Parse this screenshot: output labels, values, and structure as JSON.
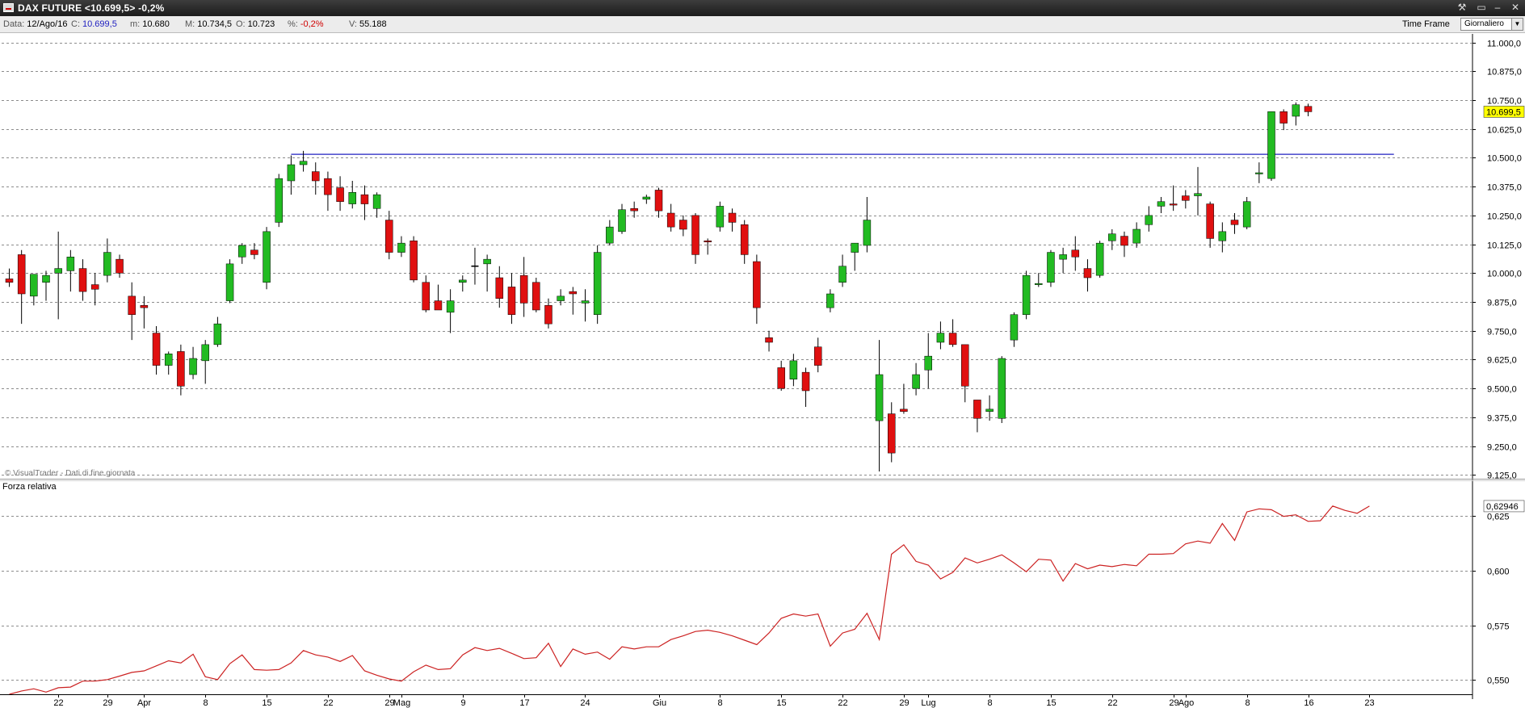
{
  "window": {
    "title": "DAX FUTURE <10.699,5> -0,2%",
    "close_glyph": "✕"
  },
  "infobar": {
    "date_label": "Data:",
    "date": "12/Ago/16",
    "close_label": "C:",
    "close": "10.699,5",
    "min_label": "m:",
    "min": "10.680",
    "max_label": "M:",
    "max": "10.734,5",
    "open_label": "O:",
    "open": "10.723",
    "pct_label": "%:",
    "pct": "-0,2%",
    "vol_label": "V:",
    "vol": "55.188",
    "timeframe_label": "Time Frame",
    "timeframe_value": "Giornaliero"
  },
  "icons": [
    "tool-icon",
    "pin-icon",
    "minimize-icon",
    "close-icon",
    "dropdown-arrow-icon",
    "app-icon"
  ],
  "colors": {
    "up": "#22bb22",
    "down": "#e01010",
    "resistance": "#2020c0",
    "indicator": "#cc2222",
    "last_price_bg": "#ffff00"
  },
  "chart_data": [
    {
      "type": "candlestick",
      "watermark": "© VisualTrader - Dati di fine giornata",
      "ylim": [
        9112,
        11030
      ],
      "y_ticks": [
        9125,
        9250,
        9375,
        9500,
        9625,
        9750,
        9875,
        10000,
        10125,
        10250,
        10375,
        10500,
        10625,
        10750,
        10875,
        11000
      ],
      "y_tick_labels": [
        "9.125,0",
        "9.250,0",
        "9.375,0",
        "9.500,0",
        "9.625,0",
        "9.750,0",
        "9.875,0",
        "10.000,0",
        "10.125,0",
        "10.250,0",
        "10.375,0",
        "10.500,0",
        "10.625,0",
        "10.750,0",
        "10.875,0",
        "11.000,0"
      ],
      "last_price": 10699.5,
      "last_price_label": "10.699,5",
      "resistance": {
        "level": 10515,
        "from_index": 23,
        "to_index": 113
      },
      "x_tick_labels": [
        {
          "index": 4,
          "label": "22",
          "month": false
        },
        {
          "index": 8,
          "label": "29",
          "month": false
        },
        {
          "index": 11,
          "label": "Apr",
          "month": true
        },
        {
          "index": 16,
          "label": "8",
          "month": false
        },
        {
          "index": 21,
          "label": "15",
          "month": false
        },
        {
          "index": 26,
          "label": "22",
          "month": false
        },
        {
          "index": 31,
          "label": "29",
          "month": false
        },
        {
          "index": 32,
          "label": "Mag",
          "month": true
        },
        {
          "index": 37,
          "label": "9",
          "month": false
        },
        {
          "index": 42,
          "label": "17",
          "month": false
        },
        {
          "index": 47,
          "label": "24",
          "month": false
        },
        {
          "index": 53,
          "label": "Giu",
          "month": true
        },
        {
          "index": 58,
          "label": "8",
          "month": false
        },
        {
          "index": 63,
          "label": "15",
          "month": false
        },
        {
          "index": 68,
          "label": "22",
          "month": false
        },
        {
          "index": 73,
          "label": "29",
          "month": false
        },
        {
          "index": 75,
          "label": "Lug",
          "month": true
        },
        {
          "index": 80,
          "label": "8",
          "month": false
        },
        {
          "index": 85,
          "label": "15",
          "month": false
        },
        {
          "index": 90,
          "label": "22",
          "month": false
        },
        {
          "index": 95,
          "label": "29",
          "month": false
        },
        {
          "index": 96,
          "label": "Ago",
          "month": true
        },
        {
          "index": 101,
          "label": "8",
          "month": false
        },
        {
          "index": 106,
          "label": "16",
          "month": false
        },
        {
          "index": 111,
          "label": "23",
          "month": false
        }
      ],
      "n_slots": 117,
      "candles": [
        {
          "o": 9975,
          "h": 10020,
          "l": 9940,
          "c": 9960
        },
        {
          "o": 10080,
          "h": 10100,
          "l": 9780,
          "c": 9910
        },
        {
          "o": 9900,
          "h": 9990,
          "l": 9860,
          "c": 9995
        },
        {
          "o": 9960,
          "h": 10010,
          "l": 9880,
          "c": 9990
        },
        {
          "o": 10000,
          "h": 10180,
          "l": 9800,
          "c": 10020
        },
        {
          "o": 10010,
          "h": 10100,
          "l": 9920,
          "c": 10070
        },
        {
          "o": 10020,
          "h": 10060,
          "l": 9880,
          "c": 9920
        },
        {
          "o": 9950,
          "h": 10000,
          "l": 9860,
          "c": 9930
        },
        {
          "o": 9990,
          "h": 10150,
          "l": 9960,
          "c": 10090
        },
        {
          "o": 10060,
          "h": 10080,
          "l": 9980,
          "c": 10000
        },
        {
          "o": 9900,
          "h": 9960,
          "l": 9710,
          "c": 9820
        },
        {
          "o": 9860,
          "h": 9900,
          "l": 9760,
          "c": 9850
        },
        {
          "o": 9740,
          "h": 9770,
          "l": 9560,
          "c": 9600
        },
        {
          "o": 9600,
          "h": 9660,
          "l": 9560,
          "c": 9650
        },
        {
          "o": 9660,
          "h": 9690,
          "l": 9470,
          "c": 9510
        },
        {
          "o": 9560,
          "h": 9680,
          "l": 9540,
          "c": 9630
        },
        {
          "o": 9620,
          "h": 9710,
          "l": 9520,
          "c": 9690
        },
        {
          "o": 9690,
          "h": 9810,
          "l": 9680,
          "c": 9780
        },
        {
          "o": 9880,
          "h": 10060,
          "l": 9870,
          "c": 10040
        },
        {
          "o": 10070,
          "h": 10130,
          "l": 10040,
          "c": 10120
        },
        {
          "o": 10100,
          "h": 10130,
          "l": 10060,
          "c": 10080
        },
        {
          "o": 9960,
          "h": 10200,
          "l": 9930,
          "c": 10180
        },
        {
          "o": 10220,
          "h": 10430,
          "l": 10200,
          "c": 10410
        },
        {
          "o": 10400,
          "h": 10510,
          "l": 10340,
          "c": 10470
        },
        {
          "o": 10470,
          "h": 10530,
          "l": 10440,
          "c": 10485
        },
        {
          "o": 10440,
          "h": 10480,
          "l": 10340,
          "c": 10400
        },
        {
          "o": 10410,
          "h": 10440,
          "l": 10270,
          "c": 10340
        },
        {
          "o": 10370,
          "h": 10420,
          "l": 10270,
          "c": 10310
        },
        {
          "o": 10300,
          "h": 10400,
          "l": 10280,
          "c": 10350
        },
        {
          "o": 10340,
          "h": 10380,
          "l": 10230,
          "c": 10300
        },
        {
          "o": 10280,
          "h": 10350,
          "l": 10240,
          "c": 10340
        },
        {
          "o": 10230,
          "h": 10270,
          "l": 10060,
          "c": 10090
        },
        {
          "o": 10090,
          "h": 10160,
          "l": 10070,
          "c": 10130
        },
        {
          "o": 10140,
          "h": 10160,
          "l": 9960,
          "c": 9970
        },
        {
          "o": 9960,
          "h": 9990,
          "l": 9830,
          "c": 9840
        },
        {
          "o": 9880,
          "h": 9950,
          "l": 9840,
          "c": 9840
        },
        {
          "o": 9830,
          "h": 9930,
          "l": 9740,
          "c": 9880
        },
        {
          "o": 9960,
          "h": 9990,
          "l": 9920,
          "c": 9970
        },
        {
          "o": 10030,
          "h": 10110,
          "l": 9950,
          "c": 10030
        },
        {
          "o": 10040,
          "h": 10080,
          "l": 9920,
          "c": 10060
        },
        {
          "o": 9980,
          "h": 10030,
          "l": 9850,
          "c": 9890
        },
        {
          "o": 9940,
          "h": 10000,
          "l": 9780,
          "c": 9820
        },
        {
          "o": 9990,
          "h": 10070,
          "l": 9810,
          "c": 9870
        },
        {
          "o": 9960,
          "h": 9980,
          "l": 9830,
          "c": 9840
        },
        {
          "o": 9860,
          "h": 9890,
          "l": 9760,
          "c": 9780
        },
        {
          "o": 9880,
          "h": 9930,
          "l": 9860,
          "c": 9900
        },
        {
          "o": 9920,
          "h": 9940,
          "l": 9820,
          "c": 9910
        },
        {
          "o": 9870,
          "h": 9930,
          "l": 9790,
          "c": 9880
        },
        {
          "o": 9820,
          "h": 10120,
          "l": 9780,
          "c": 10090
        },
        {
          "o": 10130,
          "h": 10230,
          "l": 10120,
          "c": 10200
        },
        {
          "o": 10180,
          "h": 10300,
          "l": 10170,
          "c": 10275
        },
        {
          "o": 10280,
          "h": 10310,
          "l": 10240,
          "c": 10270
        },
        {
          "o": 10320,
          "h": 10340,
          "l": 10300,
          "c": 10330
        },
        {
          "o": 10360,
          "h": 10370,
          "l": 10240,
          "c": 10270
        },
        {
          "o": 10260,
          "h": 10300,
          "l": 10180,
          "c": 10200
        },
        {
          "o": 10230,
          "h": 10250,
          "l": 10160,
          "c": 10190
        },
        {
          "o": 10250,
          "h": 10260,
          "l": 10040,
          "c": 10080
        },
        {
          "o": 10140,
          "h": 10150,
          "l": 10080,
          "c": 10135
        },
        {
          "o": 10200,
          "h": 10310,
          "l": 10180,
          "c": 10290
        },
        {
          "o": 10260,
          "h": 10280,
          "l": 10180,
          "c": 10220
        },
        {
          "o": 10210,
          "h": 10230,
          "l": 10040,
          "c": 10080
        },
        {
          "o": 10050,
          "h": 10080,
          "l": 9780,
          "c": 9850
        },
        {
          "o": 9720,
          "h": 9750,
          "l": 9660,
          "c": 9700
        },
        {
          "o": 9590,
          "h": 9620,
          "l": 9490,
          "c": 9500
        },
        {
          "o": 9540,
          "h": 9650,
          "l": 9510,
          "c": 9620
        },
        {
          "o": 9570,
          "h": 9590,
          "l": 9420,
          "c": 9490
        },
        {
          "o": 9680,
          "h": 9720,
          "l": 9570,
          "c": 9600
        },
        {
          "o": 9850,
          "h": 9930,
          "l": 9830,
          "c": 9910
        },
        {
          "o": 9960,
          "h": 10080,
          "l": 9940,
          "c": 10030
        },
        {
          "o": 10090,
          "h": 10130,
          "l": 10010,
          "c": 10130
        },
        {
          "o": 10120,
          "h": 10330,
          "l": 10090,
          "c": 10230
        },
        {
          "o": 9360,
          "h": 9710,
          "l": 9140,
          "c": 9560
        },
        {
          "o": 9390,
          "h": 9440,
          "l": 9180,
          "c": 9220
        },
        {
          "o": 9410,
          "h": 9520,
          "l": 9390,
          "c": 9400
        },
        {
          "o": 9500,
          "h": 9610,
          "l": 9470,
          "c": 9560
        },
        {
          "o": 9580,
          "h": 9740,
          "l": 9500,
          "c": 9640
        },
        {
          "o": 9700,
          "h": 9790,
          "l": 9670,
          "c": 9740
        },
        {
          "o": 9740,
          "h": 9800,
          "l": 9680,
          "c": 9690
        },
        {
          "o": 9690,
          "h": 9690,
          "l": 9440,
          "c": 9510
        },
        {
          "o": 9450,
          "h": 9450,
          "l": 9310,
          "c": 9370
        },
        {
          "o": 9400,
          "h": 9470,
          "l": 9360,
          "c": 9410
        },
        {
          "o": 9370,
          "h": 9640,
          "l": 9350,
          "c": 9630
        },
        {
          "o": 9710,
          "h": 9830,
          "l": 9680,
          "c": 9820
        },
        {
          "o": 9820,
          "h": 10010,
          "l": 9800,
          "c": 9990
        },
        {
          "o": 9950,
          "h": 10000,
          "l": 9940,
          "c": 9955
        },
        {
          "o": 9960,
          "h": 10100,
          "l": 9940,
          "c": 10090
        },
        {
          "o": 10060,
          "h": 10110,
          "l": 10000,
          "c": 10080
        },
        {
          "o": 10100,
          "h": 10160,
          "l": 10010,
          "c": 10070
        },
        {
          "o": 10020,
          "h": 10060,
          "l": 9920,
          "c": 9980
        },
        {
          "o": 9990,
          "h": 10140,
          "l": 9980,
          "c": 10130
        },
        {
          "o": 10140,
          "h": 10190,
          "l": 10100,
          "c": 10170
        },
        {
          "o": 10160,
          "h": 10180,
          "l": 10070,
          "c": 10120
        },
        {
          "o": 10130,
          "h": 10220,
          "l": 10110,
          "c": 10190
        },
        {
          "o": 10210,
          "h": 10290,
          "l": 10180,
          "c": 10250
        },
        {
          "o": 10290,
          "h": 10330,
          "l": 10260,
          "c": 10310
        },
        {
          "o": 10300,
          "h": 10380,
          "l": 10270,
          "c": 10295
        },
        {
          "o": 10335,
          "h": 10360,
          "l": 10280,
          "c": 10315
        },
        {
          "o": 10335,
          "h": 10460,
          "l": 10250,
          "c": 10345
        },
        {
          "o": 10300,
          "h": 10310,
          "l": 10110,
          "c": 10150
        },
        {
          "o": 10140,
          "h": 10220,
          "l": 10090,
          "c": 10180
        },
        {
          "o": 10230,
          "h": 10260,
          "l": 10170,
          "c": 10210
        },
        {
          "o": 10200,
          "h": 10330,
          "l": 10190,
          "c": 10310
        },
        {
          "o": 10430,
          "h": 10480,
          "l": 10390,
          "c": 10435
        },
        {
          "o": 10410,
          "h": 10700,
          "l": 10400,
          "c": 10700
        },
        {
          "o": 10700,
          "h": 10710,
          "l": 10620,
          "c": 10650
        },
        {
          "o": 10680,
          "h": 10740,
          "l": 10640,
          "c": 10730
        },
        {
          "o": 10723,
          "h": 10734.5,
          "l": 10680,
          "c": 10699.5
        }
      ]
    },
    {
      "type": "line",
      "title": "Forza relativa",
      "ylim": [
        0.5435,
        0.6405
      ],
      "y_ticks": [
        0.55,
        0.575,
        0.6,
        0.625
      ],
      "y_tick_labels": [
        "0,550",
        "0,575",
        "0,600",
        "0,625"
      ],
      "last_value": 0.62946,
      "last_value_label": "0,62946",
      "series": [
        {
          "values": [
            0.5435,
            0.545,
            0.546,
            0.5445,
            0.5465,
            0.5468,
            0.5495,
            0.5495,
            0.5502,
            0.5518,
            0.5535,
            0.5542,
            0.5565,
            0.5588,
            0.5578,
            0.5618,
            0.5515,
            0.5502,
            0.5575,
            0.5615,
            0.5548,
            0.5545,
            0.5548,
            0.5578,
            0.5635,
            0.5615,
            0.5605,
            0.5585,
            0.5612,
            0.5542,
            0.5522,
            0.5505,
            0.5495,
            0.5538,
            0.5568,
            0.5548,
            0.5552,
            0.5615,
            0.5648,
            0.5635,
            0.5645,
            0.5622,
            0.5598,
            0.5602,
            0.5668,
            0.5562,
            0.5642,
            0.5618,
            0.5628,
            0.5595,
            0.5652,
            0.5642,
            0.5652,
            0.5652,
            0.5685,
            0.5702,
            0.5722,
            0.5728,
            0.5718,
            0.5702,
            0.5682,
            0.5662,
            0.5715,
            0.5782,
            0.5802,
            0.5792,
            0.5802,
            0.5655,
            0.5715,
            0.5732,
            0.5805,
            0.5685,
            0.6075,
            0.6118,
            0.6042,
            0.6025,
            0.5962,
            0.5992,
            0.6058,
            0.6035,
            0.6052,
            0.6072,
            0.6035,
            0.5995,
            0.6052,
            0.6048,
            0.5952,
            0.6032,
            0.6008,
            0.6025,
            0.6018,
            0.6028,
            0.6022,
            0.6075,
            0.6075,
            0.6078,
            0.6122,
            0.6135,
            0.6125,
            0.6215,
            0.6138,
            0.6268,
            0.6282,
            0.6278,
            0.6248,
            0.6255,
            0.6225,
            0.6228,
            0.6295,
            0.6275,
            0.6262,
            0.62946
          ]
        }
      ]
    }
  ]
}
